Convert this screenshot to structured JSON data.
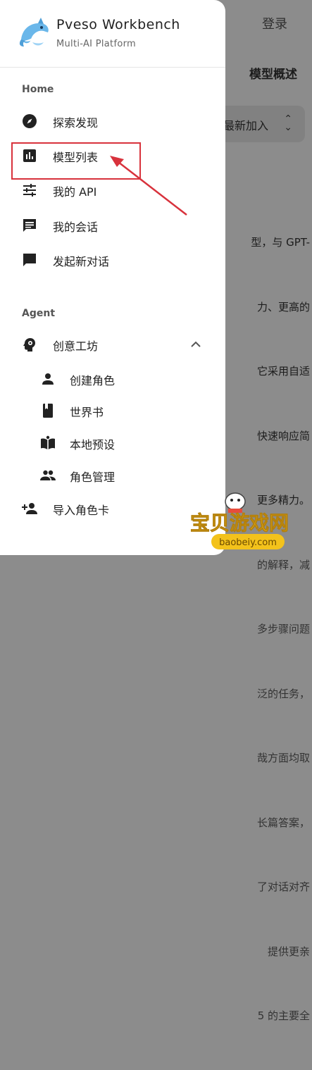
{
  "background": {
    "login_label": "登录",
    "page_title": "模型概述",
    "sort": {
      "label": "最新加入"
    },
    "text_lines": [
      "型，与 GPT-",
      "力、更高的",
      "它采用自适",
      "快速响应简",
      "更多精力。",
      "的解释，减",
      "多步骤问题",
      "泛的任务，",
      "哉方面均取",
      "长篇答案，",
      "了对话对齐",
      "提供更亲",
      "5 的主要全"
    ]
  },
  "brand": {
    "name": "Pveso Workbench",
    "subtitle": "Multi-AI Platform"
  },
  "sections": {
    "home": {
      "title": "Home",
      "items": [
        {
          "label": "探索发现",
          "icon": "compass-icon"
        },
        {
          "label": "模型列表",
          "icon": "bar-chart-icon"
        },
        {
          "label": "我的 API",
          "icon": "sliders-icon"
        },
        {
          "label": "我的会话",
          "icon": "chat-lines-icon"
        },
        {
          "label": "发起新对话",
          "icon": "chat-bubble-icon"
        }
      ]
    },
    "agent": {
      "title": "Agent",
      "group_label": "创意工坊",
      "group_icon": "head-gear-icon",
      "sub_items": [
        {
          "label": "创建角色",
          "icon": "person-icon"
        },
        {
          "label": "世界书",
          "icon": "book-icon"
        },
        {
          "label": "本地预设",
          "icon": "open-book-icon"
        },
        {
          "label": "角色管理",
          "icon": "group-icon"
        }
      ],
      "import_label": "导入角色卡",
      "import_icon": "person-add-icon"
    }
  },
  "annotation": {
    "color": "#d8323c"
  },
  "watermark": {
    "text": "宝贝游戏网",
    "url": "baobeiy.com"
  }
}
